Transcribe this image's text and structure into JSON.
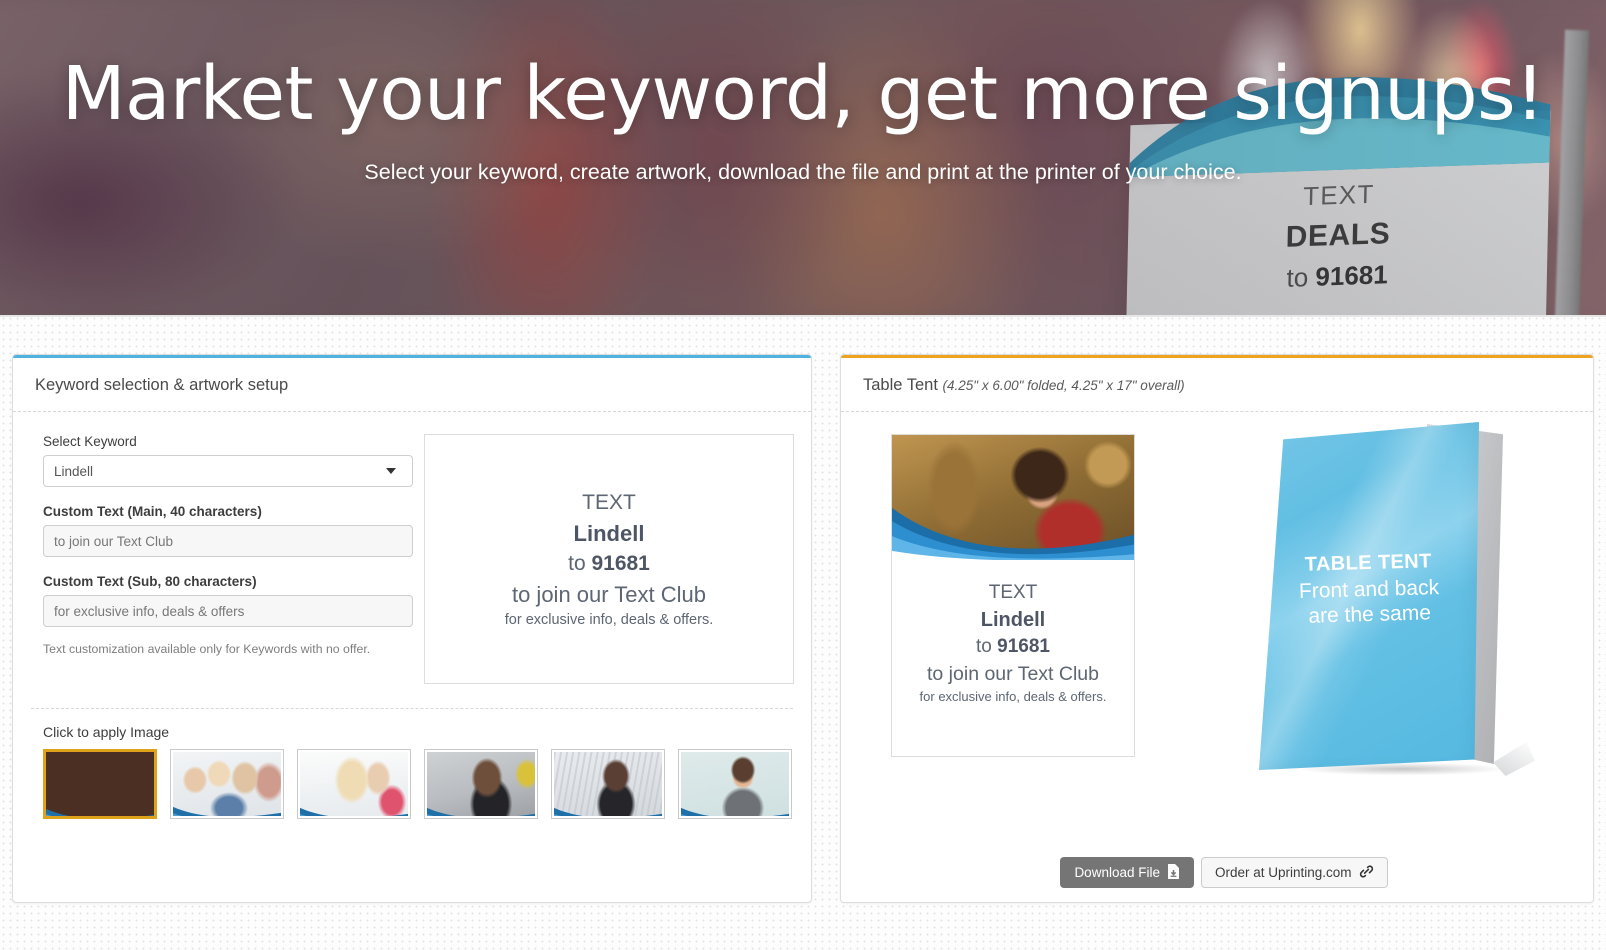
{
  "hero": {
    "title": "Market your keyword, get more signups!",
    "subtitle": "Select your keyword, create artwork, download the file and print at the printer of your choice.",
    "sign": {
      "line1": "TEXT",
      "line2": "DEALS",
      "line3_prefix": "to ",
      "line3_code": "91681"
    }
  },
  "left_panel": {
    "accent_color": "#4eb3e0",
    "title": "Keyword selection & artwork setup",
    "select_keyword": {
      "label": "Select Keyword",
      "value": "Lindell",
      "options": [
        "Lindell"
      ],
      "caret_icon": "chevron-down-icon"
    },
    "custom_main": {
      "label": "Custom Text (Main, 40 characters)",
      "value": "to join our Text Club",
      "placeholder": "to join our Text Club"
    },
    "custom_sub": {
      "label": "Custom Text (Sub, 80 characters)",
      "value": "for exclusive info, deals & offers",
      "placeholder": "for exclusive info, deals & offers"
    },
    "hint": "Text customization available only for Keywords with no offer.",
    "preview": {
      "line1": "TEXT",
      "line2": "Lindell",
      "line3_prefix": "to ",
      "line3_code": "91681",
      "line4": "to join our Text Club",
      "line5": "for exclusive info, deals & offers."
    },
    "images_label": "Click to apply Image",
    "thumbnails": [
      {
        "name": "woman-cafe-phone",
        "selected": true,
        "selected_color": "#e0a21a"
      },
      {
        "name": "group-friends-phones",
        "selected": false
      },
      {
        "name": "two-women-phone",
        "selected": false
      },
      {
        "name": "woman-street-phone",
        "selected": false
      },
      {
        "name": "man-glasses-phone",
        "selected": false
      },
      {
        "name": "man-grey-shirt-phone",
        "selected": false
      }
    ]
  },
  "right_panel": {
    "accent_color": "#eda321",
    "title": "Table Tent",
    "dimensions": "(4.25\" x 6.00\" folded, 4.25\" x 17\" overall)",
    "artwork": {
      "line1": "TEXT",
      "line2": "Lindell",
      "line3_prefix": "to ",
      "line3_code": "91681",
      "line4": "to join our Text Club",
      "line5": "for exclusive info, deals & offers."
    },
    "mockup": {
      "line1": "TABLE TENT",
      "line2": "Front and back",
      "line3": "are the same",
      "color": "#62bfe3"
    },
    "buttons": {
      "download": {
        "label": "Download File",
        "icon": "file-download-icon"
      },
      "order": {
        "label": "Order at Uprinting.com",
        "icon": "link-icon"
      }
    }
  }
}
